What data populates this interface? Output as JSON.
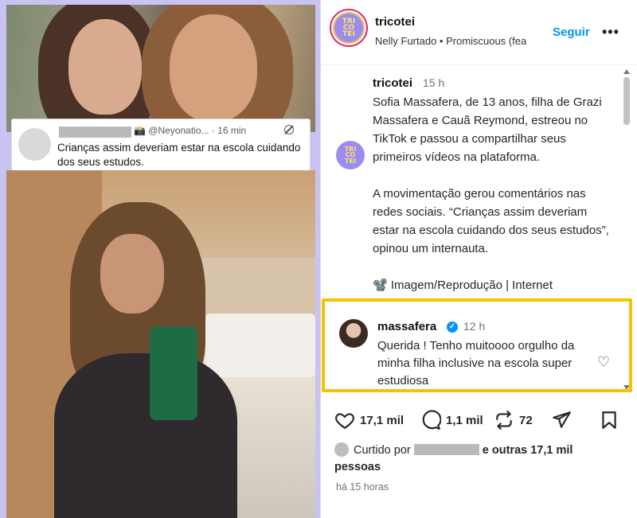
{
  "header": {
    "logo_text": "TRI\nCO\nTEI",
    "username": "tricotei",
    "audio": "Nelly Furtado • Promiscuous (fea",
    "follow_label": "Seguir",
    "more_label": "•••"
  },
  "media": {
    "tweet": {
      "handle_meta": "📸 @Neyonatio... · 16 min",
      "text": "Crianças assim deveriam estar na escola cuidando dos seus estudos."
    }
  },
  "caption": {
    "username": "tricotei",
    "time": "15 h",
    "body": "Sofia Massafera, de 13 anos, filha de Grazi Massafera e Cauã Reymond, estreou no TikTok e passou a compartilhar seus primeiros vídeos na plataforma.\n\nA movimentação gerou comentários nas redes sociais. “Crianças assim deveriam estar na escola cuidando dos seus estudos”, opinou um internauta.\n\n📽️ Imagem/Reprodução | Internet"
  },
  "comment": {
    "username": "massafera",
    "verified_mark": "✓",
    "time": "12 h",
    "body": "Querida ! Tenho muitoooo orgulho da minha filha inclusive na escola super estudiosa",
    "heart": "♡"
  },
  "actions": {
    "likes_count": "17,1 mil",
    "comments_count": "1,1 mil",
    "reposts_count": "72"
  },
  "liked_by": {
    "prefix": "Curtido por",
    "and_others": "e outras 17,1 mil pessoas"
  },
  "timestamp": "há 15 horas",
  "colors": {
    "accent_blue": "#0095f6",
    "highlight_yellow": "#f4c400",
    "media_frame": "#c9c3f2",
    "logo_purple": "#9d8cf0"
  }
}
